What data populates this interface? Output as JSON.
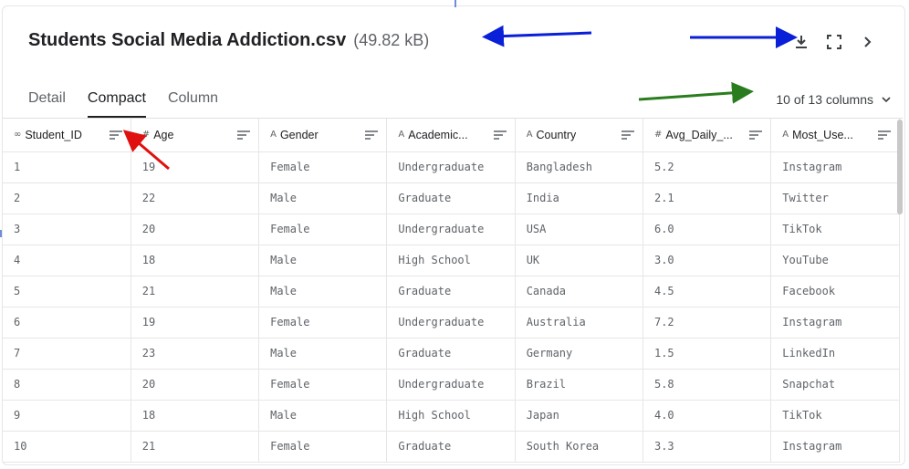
{
  "file": {
    "name": "Students Social Media Addiction.csv",
    "size": "(49.82 kB)"
  },
  "tabs": [
    {
      "label": "Detail"
    },
    {
      "label": "Compact",
      "active": true
    },
    {
      "label": "Column"
    }
  ],
  "column_selector": {
    "label": "10 of 13 columns"
  },
  "columns": [
    {
      "type_icon": "∞",
      "label": "Student_ID"
    },
    {
      "type_icon": "#",
      "label": "Age"
    },
    {
      "type_icon": "A",
      "label": "Gender"
    },
    {
      "type_icon": "A",
      "label": "Academic..."
    },
    {
      "type_icon": "A",
      "label": "Country"
    },
    {
      "type_icon": "#",
      "label": "Avg_Daily_..."
    },
    {
      "type_icon": "A",
      "label": "Most_Use..."
    }
  ],
  "rows": [
    [
      "1",
      "19",
      "Female",
      "Undergraduate",
      "Bangladesh",
      "5.2",
      "Instagram"
    ],
    [
      "2",
      "22",
      "Male",
      "Graduate",
      "India",
      "2.1",
      "Twitter"
    ],
    [
      "3",
      "20",
      "Female",
      "Undergraduate",
      "USA",
      "6.0",
      "TikTok"
    ],
    [
      "4",
      "18",
      "Male",
      "High School",
      "UK",
      "3.0",
      "YouTube"
    ],
    [
      "5",
      "21",
      "Male",
      "Graduate",
      "Canada",
      "4.5",
      "Facebook"
    ],
    [
      "6",
      "19",
      "Female",
      "Undergraduate",
      "Australia",
      "7.2",
      "Instagram"
    ],
    [
      "7",
      "23",
      "Male",
      "Graduate",
      "Germany",
      "1.5",
      "LinkedIn"
    ],
    [
      "8",
      "20",
      "Female",
      "Undergraduate",
      "Brazil",
      "5.8",
      "Snapchat"
    ],
    [
      "9",
      "18",
      "Male",
      "High School",
      "Japan",
      "4.0",
      "TikTok"
    ],
    [
      "10",
      "21",
      "Female",
      "Graduate",
      "South Korea",
      "3.3",
      "Instagram"
    ]
  ],
  "icons": {
    "download": "download-icon",
    "fullscreen": "fullscreen-icon",
    "next": "chevron-right-icon",
    "dropdown": "chevron-down-icon",
    "sort": "sort-lines-icon"
  },
  "annotation_colors": {
    "blue": "#0a1fd8",
    "green": "#2a7d1e",
    "red": "#e01010"
  }
}
